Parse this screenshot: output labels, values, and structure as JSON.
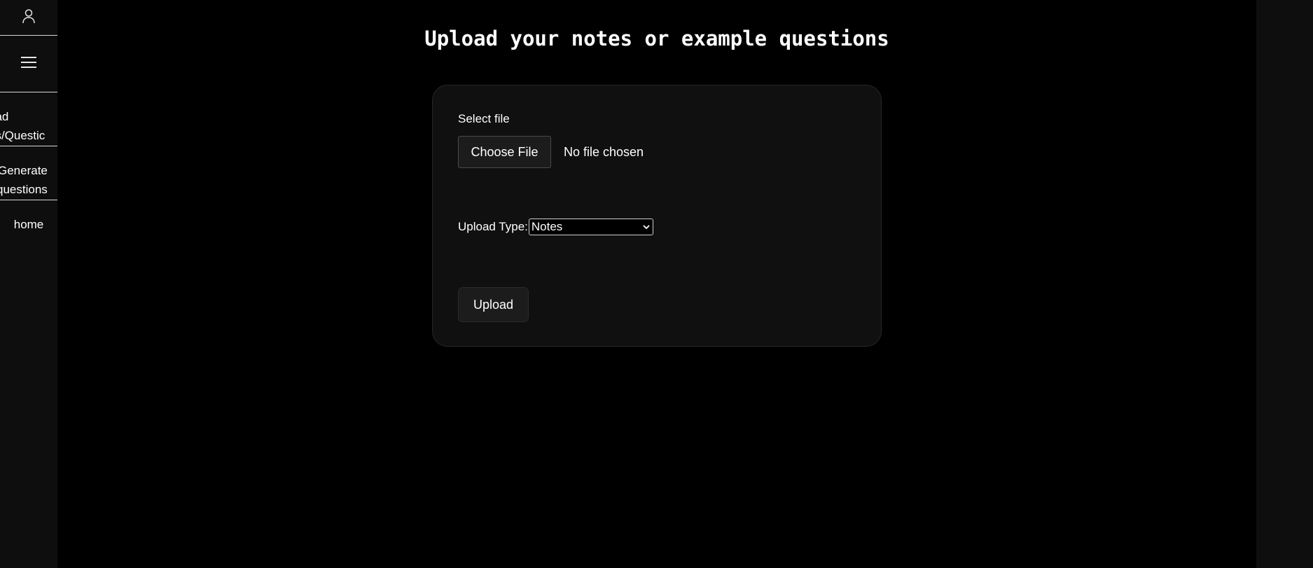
{
  "sidebar": {
    "user_icon": "user-icon",
    "menu_icon": "hamburger-menu-icon",
    "items": [
      {
        "line1": "oad",
        "line2": "es/Questic"
      },
      {
        "line1": "Generate",
        "line2": "questions"
      },
      {
        "label": "home"
      }
    ]
  },
  "main": {
    "title": "Upload your notes or example questions"
  },
  "form": {
    "file_label": "Select file",
    "choose_file_label": "Choose File",
    "file_status": "No file chosen",
    "type_label": "Upload Type:",
    "type_selected": "Notes",
    "type_chevron_icon": "chevron-down-icon",
    "upload_label": "Upload"
  },
  "colors": {
    "background": "#000000",
    "sidebar": "#0e0e0e",
    "card": "#101010",
    "button": "#1c1c1c",
    "text": "#ffffff"
  }
}
